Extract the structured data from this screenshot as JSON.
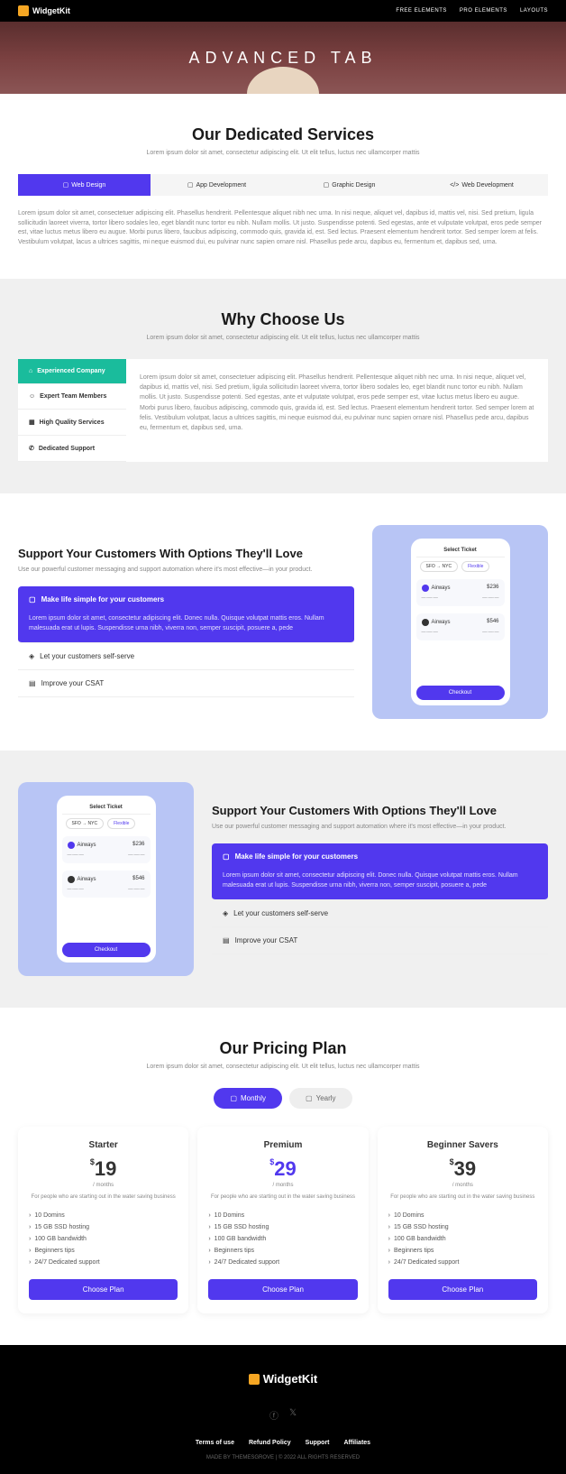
{
  "header": {
    "logo": "WidgetKit",
    "nav": [
      "FREE ELEMENTS",
      "PRO ELEMENTS",
      "LAYOUTS"
    ]
  },
  "hero": {
    "title": "ADVANCED TAB"
  },
  "services": {
    "title": "Our Dedicated Services",
    "subtitle": "Lorem ipsum dolor sit amet, consectetur adipiscing elit. Ut elit tellus, luctus nec ullamcorper mattis",
    "tabs": [
      "Web Design",
      "App Development",
      "Graphic Design",
      "Web Development"
    ],
    "content": "Lorem ipsum dolor sit amet, consectetuer adipiscing elit. Phasellus hendrerit. Pellentesque aliquet nibh nec urna. In nisi neque, aliquet vel, dapibus id, mattis vel, nisi. Sed pretium, ligula sollicitudin laoreet viverra, tortor libero sodales leo, eget blandit nunc tortor eu nibh. Nullam mollis. Ut justo. Suspendisse potenti. Sed egestas, ante et vulputate volutpat, eros pede semper est, vitae luctus metus libero eu augue. Morbi purus libero, faucibus adipiscing, commodo quis, gravida id, est. Sed lectus. Praesent elementum hendrerit tortor. Sed semper lorem at felis. Vestibulum volutpat, lacus a ultrices sagittis, mi neque euismod dui, eu pulvinar nunc sapien ornare nisl. Phasellus pede arcu, dapibus eu, fermentum et, dapibus sed, urna."
  },
  "why": {
    "title": "Why Choose Us",
    "subtitle": "Lorem ipsum dolor sit amet, consectetur adipiscing elit. Ut elit tellus, luctus nec ullamcorper mattis",
    "tabs": [
      "Experienced Company",
      "Expert Team Members",
      "High Quality Services",
      "Dedicated Support"
    ],
    "content": "Lorem ipsum dolor sit amet, consectetuer adipiscing elit. Phasellus hendrerit. Pellentesque aliquet nibh nec urna. In nisi neque, aliquet vel, dapibus id, mattis vel, nisi. Sed pretium, ligula sollicitudin laoreet viverra, tortor libero sodales leo, eget blandit nunc tortor eu nibh. Nullam mollis. Ut justo. Suspendisse potenti. Sed egestas, ante et vulputate volutpat, eros pede semper est, vitae luctus metus libero eu augue. Morbi purus libero, faucibus adipiscing, commodo quis, gravida id, est. Sed lectus. Praesent elementum hendrerit tortor. Sed semper lorem at felis. Vestibulum volutpat, lacus a ultrices sagittis, mi neque euismod dui, eu pulvinar nunc sapien ornare nisl. Phasellus pede arcu, dapibus eu, fermentum et, dapibus sed, urna."
  },
  "support": {
    "title": "Support Your Customers With Options They'll Love",
    "subtitle": "Use our powerful customer messaging and support automation where it's most effective—in your product.",
    "accordion": {
      "active_title": "Make life simple for your customers",
      "active_body": "Lorem ipsum dolor sit amet, consectetur adipiscing elit. Donec nulla. Quisque volutpat mattis eros. Nullam malesuada erat ut lupis. Suspendisse urna nibh, viverra non, semper suscipit, posuere a, pede",
      "items": [
        "Let your customers self-serve",
        "Improve your CSAT"
      ]
    }
  },
  "phone": {
    "header": "Select Ticket",
    "route_from": "SFO → NYC",
    "route_type": "Flexible",
    "airline": "Airways",
    "price1": "$236",
    "price2": "$546",
    "checkout": "Checkout"
  },
  "pricing": {
    "title": "Our Pricing Plan",
    "subtitle": "Lorem ipsum dolor sit amet, consectetur adipiscing elit. Ut elit tellus, luctus nec ullamcorper mattis",
    "tabs": [
      "Monthly",
      "Yearly"
    ],
    "period": "/ months",
    "desc": "For people who are starting out in the water saving business",
    "plans": [
      {
        "name": "Starter",
        "price": "19"
      },
      {
        "name": "Premium",
        "price": "29"
      },
      {
        "name": "Beginner Savers",
        "price": "39"
      }
    ],
    "features": [
      "10 Domins",
      "15 GB SSD hosting",
      "100 GB bandwidth",
      "Beginners tips",
      "24/7 Dedicated support"
    ],
    "button": "Choose Plan"
  },
  "footer": {
    "logo": "WidgetKit",
    "links": [
      "Terms of use",
      "Refund Policy",
      "Support",
      "Affiliates"
    ],
    "copyright": "MADE BY THEMESGROVE | © 2022 ALL RIGHTS RESERVED"
  }
}
